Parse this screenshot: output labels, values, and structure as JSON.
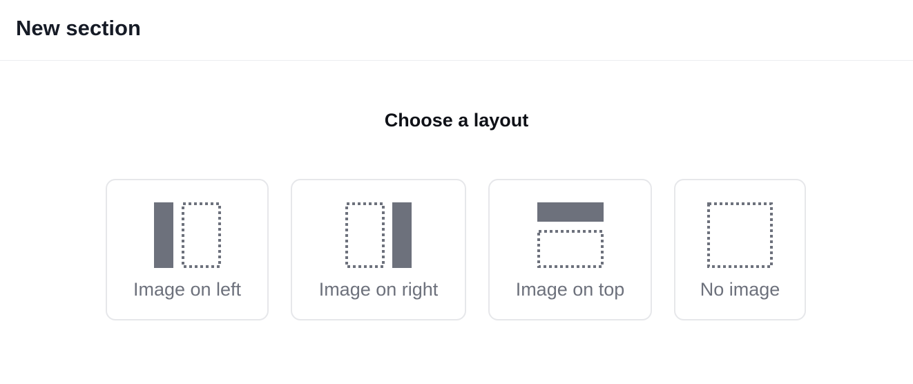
{
  "header": {
    "title": "New section"
  },
  "main": {
    "heading": "Choose a layout",
    "layouts": [
      {
        "label": "Image on left",
        "icon": "image-left-layout-icon"
      },
      {
        "label": "Image on right",
        "icon": "image-right-layout-icon"
      },
      {
        "label": "Image on top",
        "icon": "image-top-layout-icon"
      },
      {
        "label": "No image",
        "icon": "no-image-layout-icon"
      }
    ]
  },
  "colors": {
    "icon_fill": "#6d717c",
    "card_border": "#e6e7ea",
    "label": "#6d717c"
  }
}
